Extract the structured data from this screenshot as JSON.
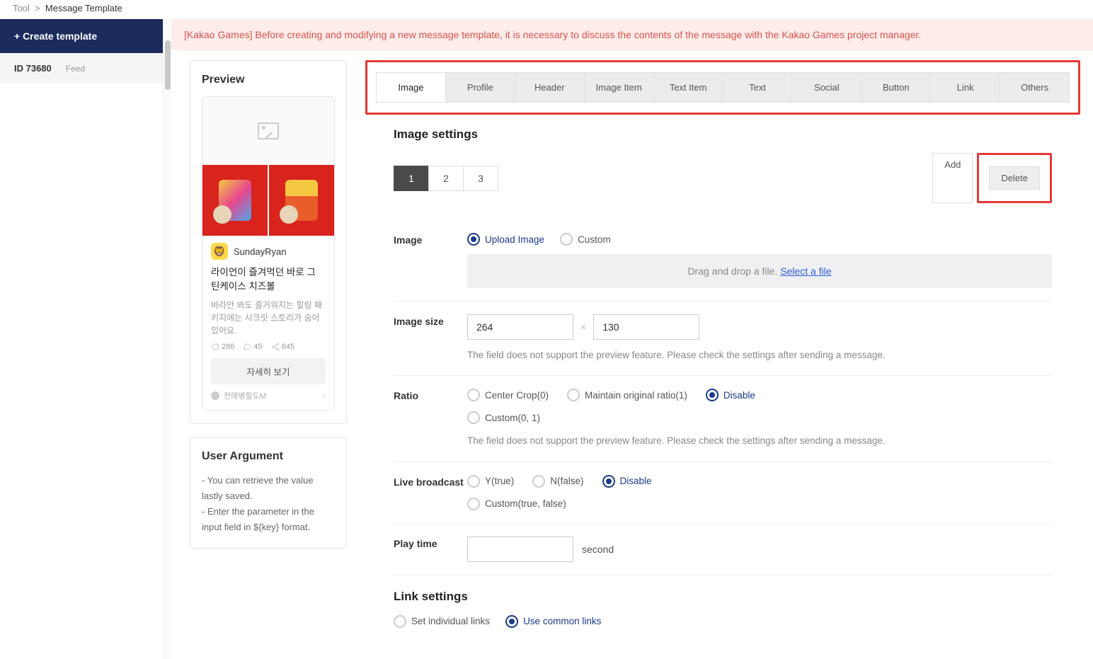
{
  "breadcrumb": {
    "root": "Tool",
    "sep": ">",
    "current": "Message Template"
  },
  "sidebar": {
    "create": "+ Create template",
    "item": {
      "id": "ID 73680",
      "type": "Feed"
    }
  },
  "alert": "[Kakao Games] Before creating and modifying a new message template, it is necessary to discuss the contents of the message with the Kakao Games project manager.",
  "preview": {
    "title": "Preview",
    "profile_name": "SundayRyan",
    "card_title": "라이언이 즐겨먹던 바로 그 틴케이스 치즈볼",
    "card_desc": "바라만 봐도 즐거워지는 힐링 패키지에는 시크릿 스토리가 숨어있어요.",
    "like": "286",
    "comment": "45",
    "share": "845",
    "button": "자세히 보기",
    "footer": "전애병힐도M"
  },
  "user_arg": {
    "title": "User Argument",
    "line1": "- You can retrieve the value lastly saved.",
    "line2": "- Enter the parameter in the input field in ${key} format."
  },
  "tabs": [
    "Image",
    "Profile",
    "Header",
    "Image Item",
    "Text Item",
    "Text",
    "Social",
    "Button",
    "Link",
    "Others"
  ],
  "settings": {
    "title": "Image settings",
    "nums": [
      "1",
      "2",
      "3"
    ],
    "add": "Add",
    "delete": "Delete",
    "image_label": "Image",
    "image_radios": {
      "upload": "Upload Image",
      "custom": "Custom"
    },
    "drop_text": "Drag and drop a file. ",
    "drop_link": "Select a file",
    "size_label": "Image size",
    "size_w": "264",
    "size_h": "130",
    "size_help": "The field does not support the preview feature. Please check the settings after sending a message.",
    "ratio_label": "Ratio",
    "ratio": {
      "crop": "Center Crop(0)",
      "maintain": "Maintain original ratio(1)",
      "disable": "Disable",
      "custom": "Custom(0, 1)"
    },
    "ratio_help": "The field does not support the preview feature. Please check the settings after sending a message.",
    "live_label": "Live broadcast",
    "live": {
      "y": "Y(true)",
      "n": "N(false)",
      "disable": "Disable",
      "custom": "Custom(true, false)"
    },
    "play_label": "Play time",
    "play_unit": "second",
    "link_title": "Link settings",
    "link": {
      "individual": "Set individual links",
      "common": "Use common links"
    }
  }
}
